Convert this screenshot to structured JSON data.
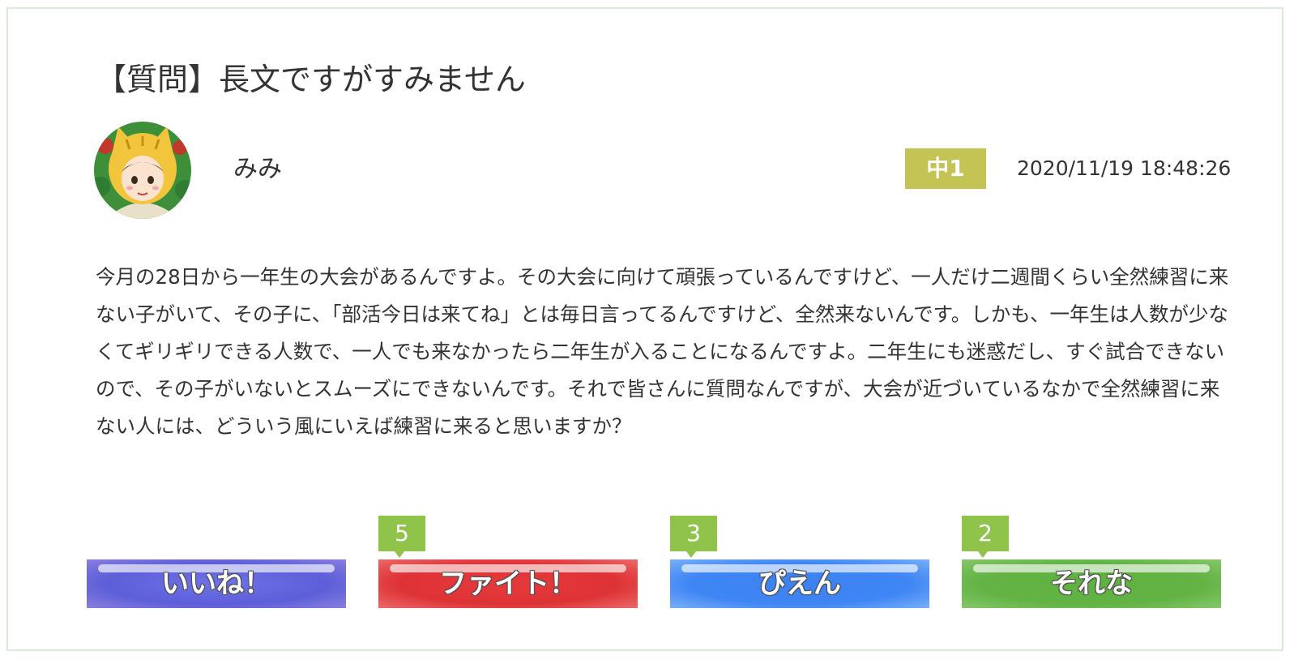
{
  "post": {
    "title": "【質問】長文ですがすみません",
    "username": "みみ",
    "grade": "中1",
    "timestamp": "2020/11/19 18:48:26",
    "body": "今月の28日から一年生の大会があるんですよ。その大会に向けて頑張っているんですけど、一人だけ二週間くらい全然練習に来ない子がいて、その子に、「部活今日は来てね」とは毎日言ってるんですけど、全然来ないんです。しかも、一年生は人数が少なくてギリギリできる人数で、一人でも来なかったら二年生が入ることになるんですよ。二年生にも迷惑だし、すぐ試合できないので、その子がいないとスムーズにできないんです。それで皆さんに質問なんですが、大会が近づいているなかで全然練習に来ない人には、どういう風にいえば練習に来ると思いますか？"
  },
  "reactions": [
    {
      "label": "いいね！",
      "count": null,
      "color": "#5c5fd8"
    },
    {
      "label": "ファイト！",
      "count": "5",
      "color": "#de3336"
    },
    {
      "label": "ぴえん",
      "count": "3",
      "color": "#3f86f5"
    },
    {
      "label": "それな",
      "count": "2",
      "color": "#62b344"
    }
  ],
  "colors": {
    "grade_badge": "#c3c453",
    "count_badge": "#8fc34a",
    "card_border": "#d6ecd6"
  }
}
